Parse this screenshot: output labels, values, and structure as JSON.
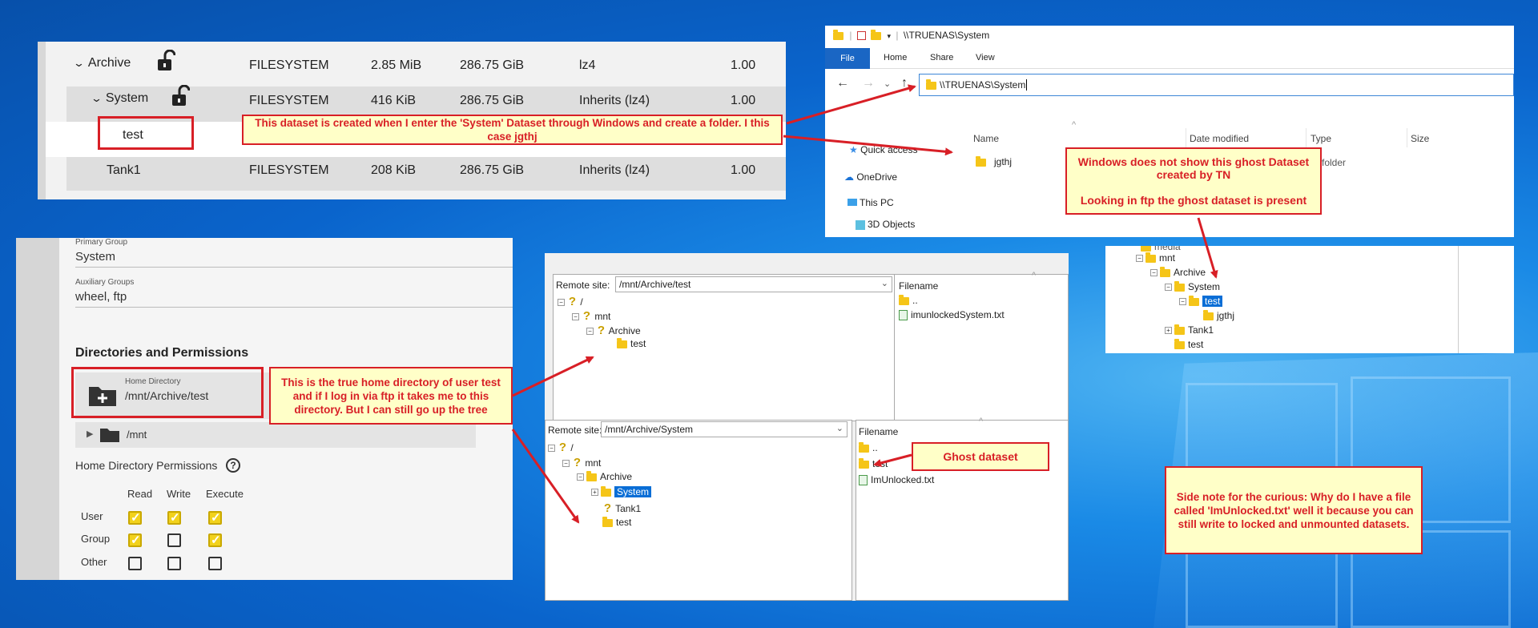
{
  "dataset_table": {
    "rows": [
      {
        "name": "Archive",
        "type": "FILESYSTEM",
        "used": "2.85 MiB",
        "available": "286.75 GiB",
        "compression": "lz4",
        "ratio": "1.00"
      },
      {
        "name": "System",
        "type": "FILESYSTEM",
        "used": "416 KiB",
        "available": "286.75 GiB",
        "compression": "Inherits (lz4)",
        "ratio": "1.00"
      },
      {
        "name": "test"
      },
      {
        "name": "Tank1",
        "type": "FILESYSTEM",
        "used": "208 KiB",
        "available": "286.75 GiB",
        "compression": "Inherits (lz4)",
        "ratio": "1.00"
      }
    ]
  },
  "notes": {
    "created_dataset": "This dataset is created when I enter the 'System' Dataset through Windows and create a folder. I this case jgthj",
    "windows_ghost": "Windows does not show this ghost Dataset created by TN\n\nLooking in ftp the ghost dataset is present",
    "home_dir": "This is the true home directory of user test and if I log in via ftp it takes me to this directory. But I can still go up the tree",
    "ghost": "Ghost dataset",
    "side": "Side note for the curious: Why do I have a file called 'ImUnlocked.txt' well it because you can still write to locked and unmounted datasets."
  },
  "explorer": {
    "title": "\\\\TRUENAS\\System",
    "ribbon_tabs": [
      "File",
      "Home",
      "Share",
      "View"
    ],
    "address": "\\\\TRUENAS\\System",
    "columns": [
      "Name",
      "Date modified",
      "Type",
      "Size"
    ],
    "nav": [
      "Quick access",
      "OneDrive",
      "This PC",
      "3D Objects"
    ],
    "files": [
      {
        "name": "jgthj",
        "type": "File folder"
      }
    ],
    "type_visible": "e folder"
  },
  "ftp_tree_right": [
    "mnt",
    "Archive",
    "System",
    "test",
    "jgthj",
    "Tank1",
    "test"
  ],
  "ftp_tree_right_partial": "media",
  "user_form": {
    "primary_group_label": "Primary Group",
    "primary_group": "System",
    "aux_groups_label": "Auxiliary Groups",
    "aux_groups": "wheel, ftp",
    "section_title": "Directories and Permissions",
    "home_dir_label": "Home Directory",
    "home_dir": "/mnt/Archive/test",
    "tree_item": "/mnt",
    "perm_title": "Home Directory Permissions",
    "perm_cols": [
      "Read",
      "Write",
      "Execute"
    ],
    "perm_rows": [
      {
        "label": "User",
        "values": [
          true,
          true,
          true
        ]
      },
      {
        "label": "Group",
        "values": [
          true,
          false,
          true
        ]
      },
      {
        "label": "Other",
        "values": [
          false,
          false,
          false
        ]
      }
    ],
    "help_icon": "?"
  },
  "ftp_top": {
    "remote_label": "Remote site:",
    "remote_path": "/mnt/Archive/test",
    "tree": [
      "/",
      "mnt",
      "Archive",
      "test"
    ],
    "filename_header": "Filename",
    "files": [
      "..",
      "imunlockedSystem.txt"
    ]
  },
  "ftp_bottom": {
    "remote_label": "Remote site:",
    "remote_path": "/mnt/Archive/System",
    "tree": [
      "/",
      "mnt",
      "Archive",
      "System",
      "Tank1",
      "test"
    ],
    "filename_header": "Filename",
    "files": [
      "..",
      "test",
      "ImUnlocked.txt"
    ]
  },
  "colors": {
    "accent_red": "#d81f26",
    "note_bg": "#ffffc8",
    "checkbox": "#f2d21c",
    "explorer_blue": "#1a66c4"
  }
}
